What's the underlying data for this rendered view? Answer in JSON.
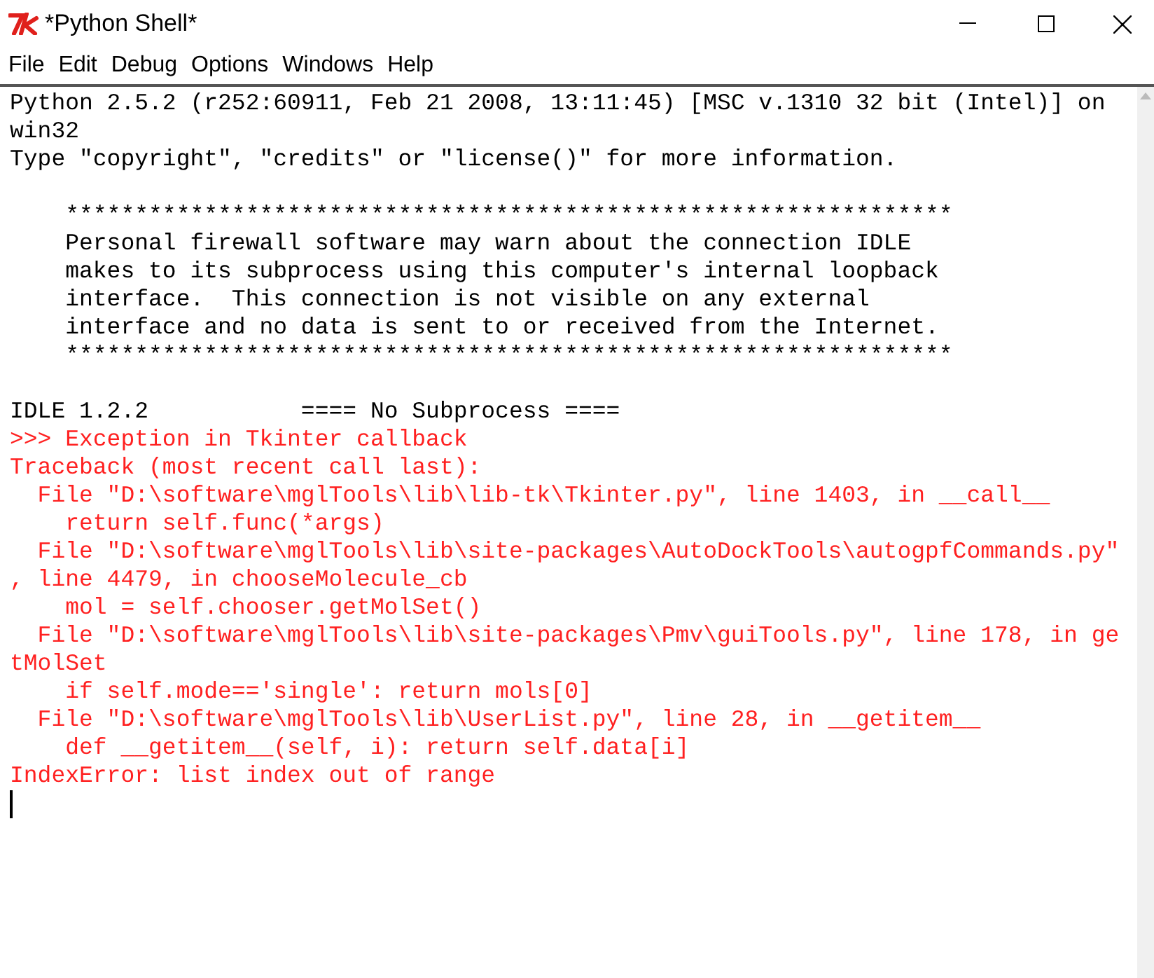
{
  "window": {
    "title": "*Python Shell*"
  },
  "menu": [
    "File",
    "Edit",
    "Debug",
    "Options",
    "Windows",
    "Help"
  ],
  "shell_lines": [
    {
      "kind": "output",
      "text": "Python 2.5.2 (r252:60911, Feb 21 2008, 13:11:45) [MSC v.1310 32 bit (Intel)] on"
    },
    {
      "kind": "output",
      "text": "win32"
    },
    {
      "kind": "output",
      "text": "Type \"copyright\", \"credits\" or \"license()\" for more information."
    },
    {
      "kind": "blank"
    },
    {
      "kind": "output",
      "text": "    ****************************************************************"
    },
    {
      "kind": "output",
      "text": "    Personal firewall software may warn about the connection IDLE"
    },
    {
      "kind": "output",
      "text": "    makes to its subprocess using this computer's internal loopback"
    },
    {
      "kind": "output",
      "text": "    interface.  This connection is not visible on any external"
    },
    {
      "kind": "output",
      "text": "    interface and no data is sent to or received from the Internet."
    },
    {
      "kind": "output",
      "text": "    ****************************************************************"
    },
    {
      "kind": "blank"
    },
    {
      "kind": "output",
      "text": "IDLE 1.2.2           ==== No Subprocess ===="
    },
    {
      "kind": "error",
      "text": ">>> Exception in Tkinter callback"
    },
    {
      "kind": "error",
      "text": "Traceback (most recent call last):"
    },
    {
      "kind": "error",
      "text": "  File \"D:\\software\\mglTools\\lib\\lib-tk\\Tkinter.py\", line 1403, in __call__"
    },
    {
      "kind": "error",
      "text": "    return self.func(*args)"
    },
    {
      "kind": "error",
      "text": "  File \"D:\\software\\mglTools\\lib\\site-packages\\AutoDockTools\\autogpfCommands.py\""
    },
    {
      "kind": "error",
      "text": ", line 4479, in chooseMolecule_cb"
    },
    {
      "kind": "error",
      "text": "    mol = self.chooser.getMolSet()"
    },
    {
      "kind": "error",
      "text": "  File \"D:\\software\\mglTools\\lib\\site-packages\\Pmv\\guiTools.py\", line 178, in ge"
    },
    {
      "kind": "error",
      "text": "tMolSet"
    },
    {
      "kind": "error",
      "text": "    if self.mode=='single': return mols[0]"
    },
    {
      "kind": "error",
      "text": "  File \"D:\\software\\mglTools\\lib\\UserList.py\", line 28, in __getitem__"
    },
    {
      "kind": "error",
      "text": "    def __getitem__(self, i): return self.data[i]"
    },
    {
      "kind": "error",
      "text": "IndexError: list index out of range"
    },
    {
      "kind": "cursor"
    }
  ]
}
